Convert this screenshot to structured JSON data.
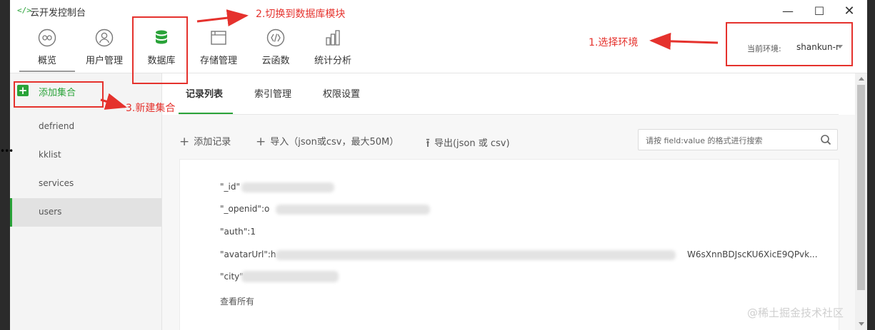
{
  "window": {
    "title": "云开发控制台",
    "controls": {
      "minimize": "—",
      "maximize": "☐",
      "close": "✕"
    }
  },
  "toolbar": {
    "items": [
      {
        "label": "概览",
        "icon": "infinity-icon"
      },
      {
        "label": "用户管理",
        "icon": "user-icon"
      },
      {
        "label": "数据库",
        "icon": "database-icon",
        "active": true
      },
      {
        "label": "存储管理",
        "icon": "folder-icon"
      },
      {
        "label": "云函数",
        "icon": "function-icon"
      },
      {
        "label": "统计分析",
        "icon": "bar-chart-icon"
      }
    ],
    "env_label": "当前环境:",
    "env_value": "shankun-r"
  },
  "sidebar": {
    "add_collection": "添加集合",
    "collections": [
      "defriend",
      "kklist",
      "services",
      "users"
    ],
    "active": "users"
  },
  "tabs": {
    "items": [
      "记录列表",
      "索引管理",
      "权限设置"
    ],
    "active": "记录列表"
  },
  "actions": {
    "add_record": "添加记录",
    "import": "导入（json或csv，最大50M）",
    "export": "导出(json 或 csv)",
    "search_placeholder": "请按 field:value 的格式进行搜索"
  },
  "record": {
    "id_key": "\"_id\"",
    "openid_key": "\"_openid\":o",
    "auth": "\"auth\":1",
    "avatar_key": "\"avatarUrl\":h",
    "avatar_tail": "W6sXnnBDJscKU6XicE9QPvk...",
    "city_key": "\"city\"",
    "view_all": "查看所有"
  },
  "annotations": {
    "step1": "1.选择环境",
    "step2": "2.切换到数据库模块",
    "step3": "3.新建集合",
    "color": "#e5322d"
  },
  "watermark": "@稀土掘金技术社区",
  "colors": {
    "accent": "#2aa339",
    "annotation": "#e5322d"
  }
}
